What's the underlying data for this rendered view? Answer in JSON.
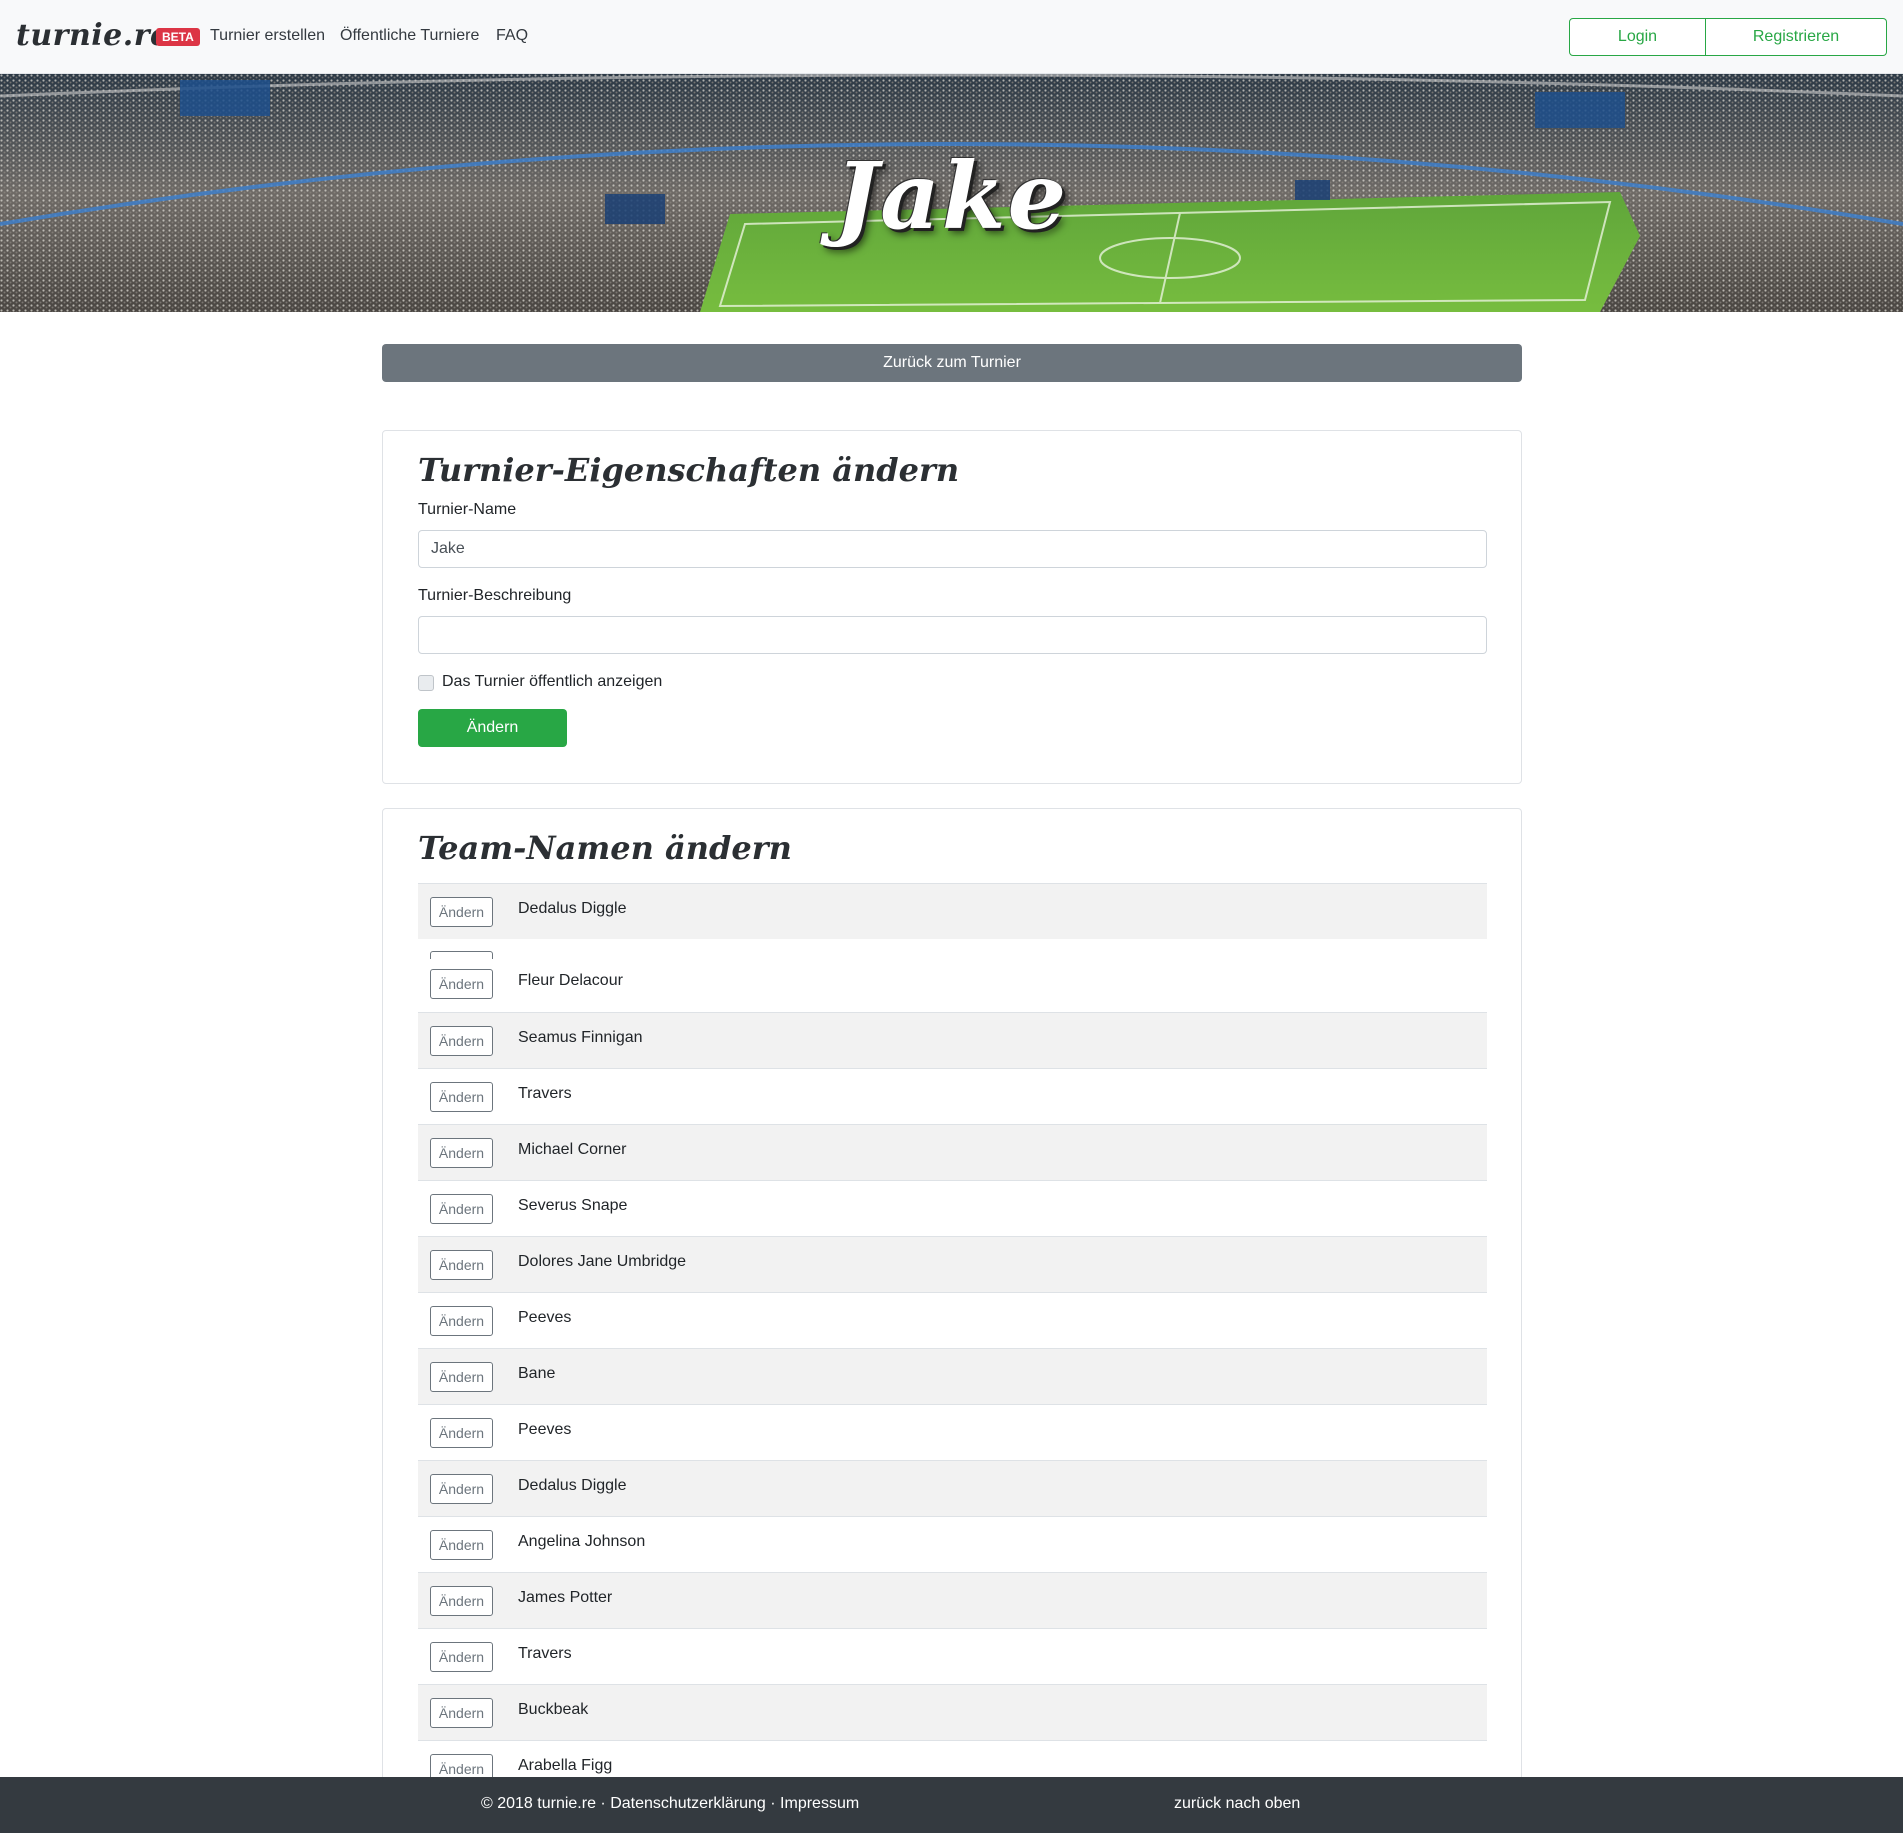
{
  "navbar": {
    "brand": "turnie.re",
    "badge": "BETA",
    "links": [
      "Turnier erstellen",
      "Öffentliche Turniere",
      "FAQ"
    ],
    "login": "Login",
    "register": "Registrieren"
  },
  "hero": {
    "title": "Jake"
  },
  "back_button": "Zurück zum Turnier",
  "properties": {
    "title": "Turnier-Eigenschaften ändern",
    "name_label": "Turnier-Name",
    "name_value": "Jake",
    "description_label": "Turnier-Beschreibung",
    "description_value": "",
    "public_label": "Das Turnier öffentlich anzeigen",
    "public_checked": false,
    "submit": "Ändern"
  },
  "teams": {
    "title": "Team-Namen ändern",
    "button_label": "Ändern",
    "items": [
      "Dedalus Diggle",
      "Fleur Delacour",
      "Seamus Finnigan",
      "Travers",
      "Michael Corner",
      "Severus Snape",
      "Dolores Jane Umbridge",
      "Peeves",
      "Bane",
      "Peeves",
      "Dedalus Diggle",
      "Angelina Johnson",
      "James Potter",
      "Travers",
      "Buckbeak",
      "Arabella Figg"
    ]
  },
  "footer": {
    "left": "© 2018 turnie.re · Datenschutzerklärung · Impressum",
    "right": "zurück nach oben"
  },
  "colors": {
    "success": "#28a745",
    "secondary": "#6c757d",
    "danger": "#dc3545",
    "dark": "#343a40"
  }
}
